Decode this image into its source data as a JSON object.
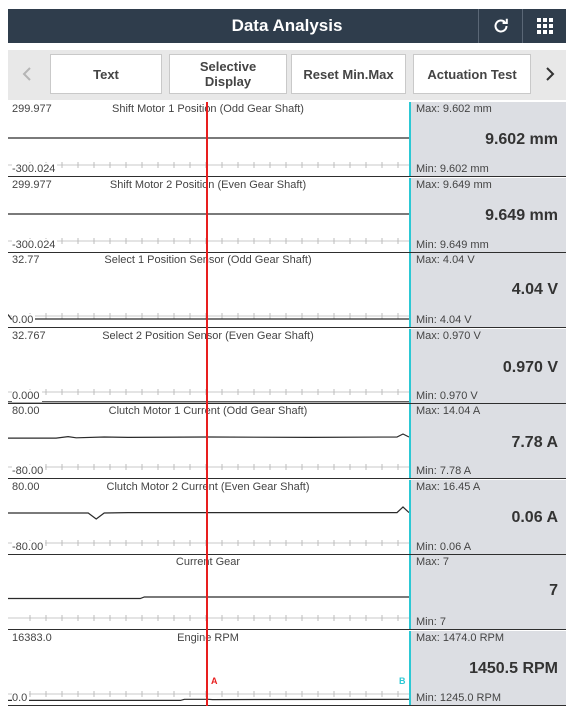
{
  "header": {
    "title": "Data Analysis",
    "refresh_icon": "refresh-icon",
    "grid_icon": "grid-menu-icon",
    "bg_color": "#2f3d4c"
  },
  "toolbar": {
    "prev_icon": "chevron-left-icon",
    "next_icon": "chevron-right-icon",
    "buttons": [
      {
        "label": "Text"
      },
      {
        "label": "Selective Display"
      },
      {
        "label": "Reset Min.Max"
      },
      {
        "label": "Actuation Test"
      }
    ]
  },
  "cursors": {
    "a": "A",
    "b": "B",
    "a_color": "#e81e1e",
    "b_color": "#2cc8d4"
  },
  "rows": [
    {
      "name": "Shift Motor 1 Position (Odd Gear Shaft)",
      "ymax": "299.977",
      "ymin": "-300.024",
      "max": "Max: 9.602 mm",
      "current": "9.602 mm",
      "min": "Min: 9.602 mm",
      "trace": [
        [
          0,
          0.52
        ],
        [
          1,
          0.52
        ]
      ]
    },
    {
      "name": "Shift Motor 2 Position (Even Gear Shaft)",
      "ymax": "299.977",
      "ymin": "-300.024",
      "max": "Max: 9.649 mm",
      "current": "9.649 mm",
      "min": "Min: 9.649 mm",
      "trace": [
        [
          0,
          0.52
        ],
        [
          1,
          0.52
        ]
      ]
    },
    {
      "name": "Select 1 Position Sensor (Odd Gear Shaft)",
      "ymax": "32.77",
      "ymin": "0.00",
      "max": "Max: 4.04 V",
      "current": "4.04 V",
      "min": "Min: 4.04 V",
      "trace": [
        [
          0,
          0.18
        ],
        [
          0.008,
          0.12
        ],
        [
          1,
          0.12
        ]
      ]
    },
    {
      "name": "Select 2 Position Sensor (Even Gear Shaft)",
      "ymax": "32.767",
      "ymin": "0.000",
      "max": "Max: 0.970 V",
      "current": "0.970 V",
      "min": "Min: 0.970 V",
      "trace": [
        [
          0,
          0.03
        ],
        [
          1,
          0.03
        ]
      ]
    },
    {
      "name": "Clutch Motor 1 Current (Odd Gear Shaft)",
      "ymax": "80.00",
      "ymin": "-80.00",
      "max": "Max: 14.04 A",
      "current": "7.78 A",
      "min": "Min: 7.78 A",
      "trace": [
        [
          0,
          0.545
        ],
        [
          0.12,
          0.545
        ],
        [
          0.15,
          0.565
        ],
        [
          0.17,
          0.55
        ],
        [
          0.24,
          0.56
        ],
        [
          0.3,
          0.555
        ],
        [
          0.5,
          0.56
        ],
        [
          0.75,
          0.555
        ],
        [
          0.97,
          0.56
        ],
        [
          0.985,
          0.6
        ],
        [
          1,
          0.56
        ]
      ]
    },
    {
      "name": "Clutch Motor 2 Current (Even Gear Shaft)",
      "ymax": "80.00",
      "ymin": "-80.00",
      "max": "Max: 16.45 A",
      "current": "0.06 A",
      "min": "Min: 0.06 A",
      "trace": [
        [
          0,
          0.56
        ],
        [
          0.2,
          0.56
        ],
        [
          0.22,
          0.48
        ],
        [
          0.24,
          0.56
        ],
        [
          0.3,
          0.565
        ],
        [
          0.97,
          0.565
        ],
        [
          0.985,
          0.64
        ],
        [
          1,
          0.565
        ]
      ]
    },
    {
      "name": "Current Gear",
      "ymax": "",
      "ymin": "",
      "max": "Max: 7",
      "current": "7",
      "min": "Min: 7",
      "trace": [
        [
          0,
          0.42
        ],
        [
          0.33,
          0.42
        ],
        [
          0.34,
          0.44
        ],
        [
          1,
          0.44
        ]
      ]
    },
    {
      "name": "Engine RPM",
      "ymax": "16383.0",
      "ymin": "0.0",
      "max": "Max: 1474.0 RPM",
      "current": "1450.5 RPM",
      "min": "Min: 1245.0 RPM",
      "trace": [
        [
          0,
          0.075
        ],
        [
          0.43,
          0.075
        ],
        [
          0.44,
          0.09
        ],
        [
          0.5,
          0.09
        ],
        [
          0.51,
          0.085
        ],
        [
          1,
          0.09
        ]
      ]
    }
  ]
}
